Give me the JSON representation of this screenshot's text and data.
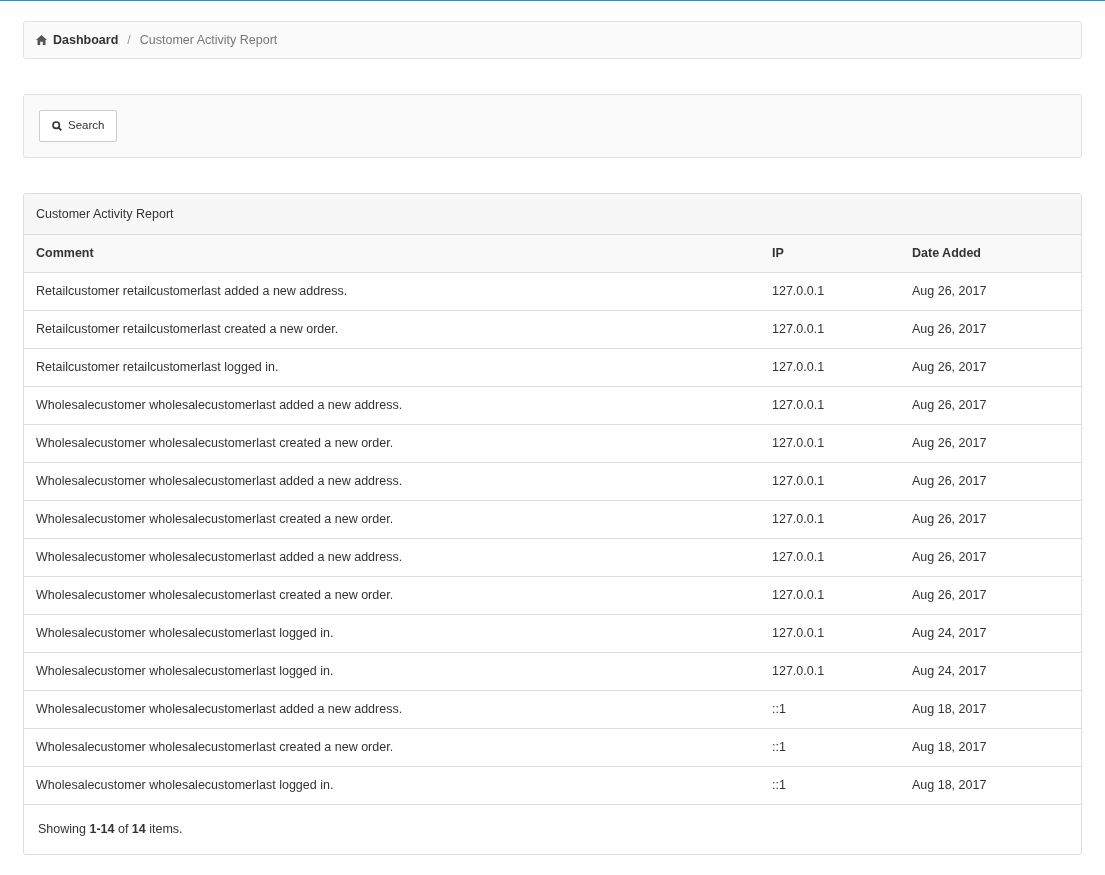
{
  "breadcrumb": [
    {
      "label": "Dashboard",
      "kind": "link"
    },
    {
      "label": "Customer Activity Report",
      "kind": "current"
    }
  ],
  "breadcrumb_separator": "/",
  "search_button": {
    "label": "Search"
  },
  "panel": {
    "title": "Customer Activity Report"
  },
  "table": {
    "columns": [
      "Comment",
      "IP",
      "Date Added"
    ],
    "rows": [
      [
        "Retailcustomer retailcustomerlast added a new address.",
        "127.0.0.1",
        "Aug 26, 2017"
      ],
      [
        "Retailcustomer retailcustomerlast created a new order.",
        "127.0.0.1",
        "Aug 26, 2017"
      ],
      [
        "Retailcustomer retailcustomerlast logged in.",
        "127.0.0.1",
        "Aug 26, 2017"
      ],
      [
        "Wholesalecustomer wholesalecustomerlast added a new address.",
        "127.0.0.1",
        "Aug 26, 2017"
      ],
      [
        "Wholesalecustomer wholesalecustomerlast created a new order.",
        "127.0.0.1",
        "Aug 26, 2017"
      ],
      [
        "Wholesalecustomer wholesalecustomerlast added a new address.",
        "127.0.0.1",
        "Aug 26, 2017"
      ],
      [
        "Wholesalecustomer wholesalecustomerlast created a new order.",
        "127.0.0.1",
        "Aug 26, 2017"
      ],
      [
        "Wholesalecustomer wholesalecustomerlast added a new address.",
        "127.0.0.1",
        "Aug 26, 2017"
      ],
      [
        "Wholesalecustomer wholesalecustomerlast created a new order.",
        "127.0.0.1",
        "Aug 26, 2017"
      ],
      [
        "Wholesalecustomer wholesalecustomerlast logged in.",
        "127.0.0.1",
        "Aug 24, 2017"
      ],
      [
        "Wholesalecustomer wholesalecustomerlast logged in.",
        "127.0.0.1",
        "Aug 24, 2017"
      ],
      [
        "Wholesalecustomer wholesalecustomerlast added a new address.",
        "::1",
        "Aug 18, 2017"
      ],
      [
        "Wholesalecustomer wholesalecustomerlast created a new order.",
        "::1",
        "Aug 18, 2017"
      ],
      [
        "Wholesalecustomer wholesalecustomerlast logged in.",
        "::1",
        "Aug 18, 2017"
      ]
    ]
  },
  "summary": "Showing **1-14** of **14** items."
}
